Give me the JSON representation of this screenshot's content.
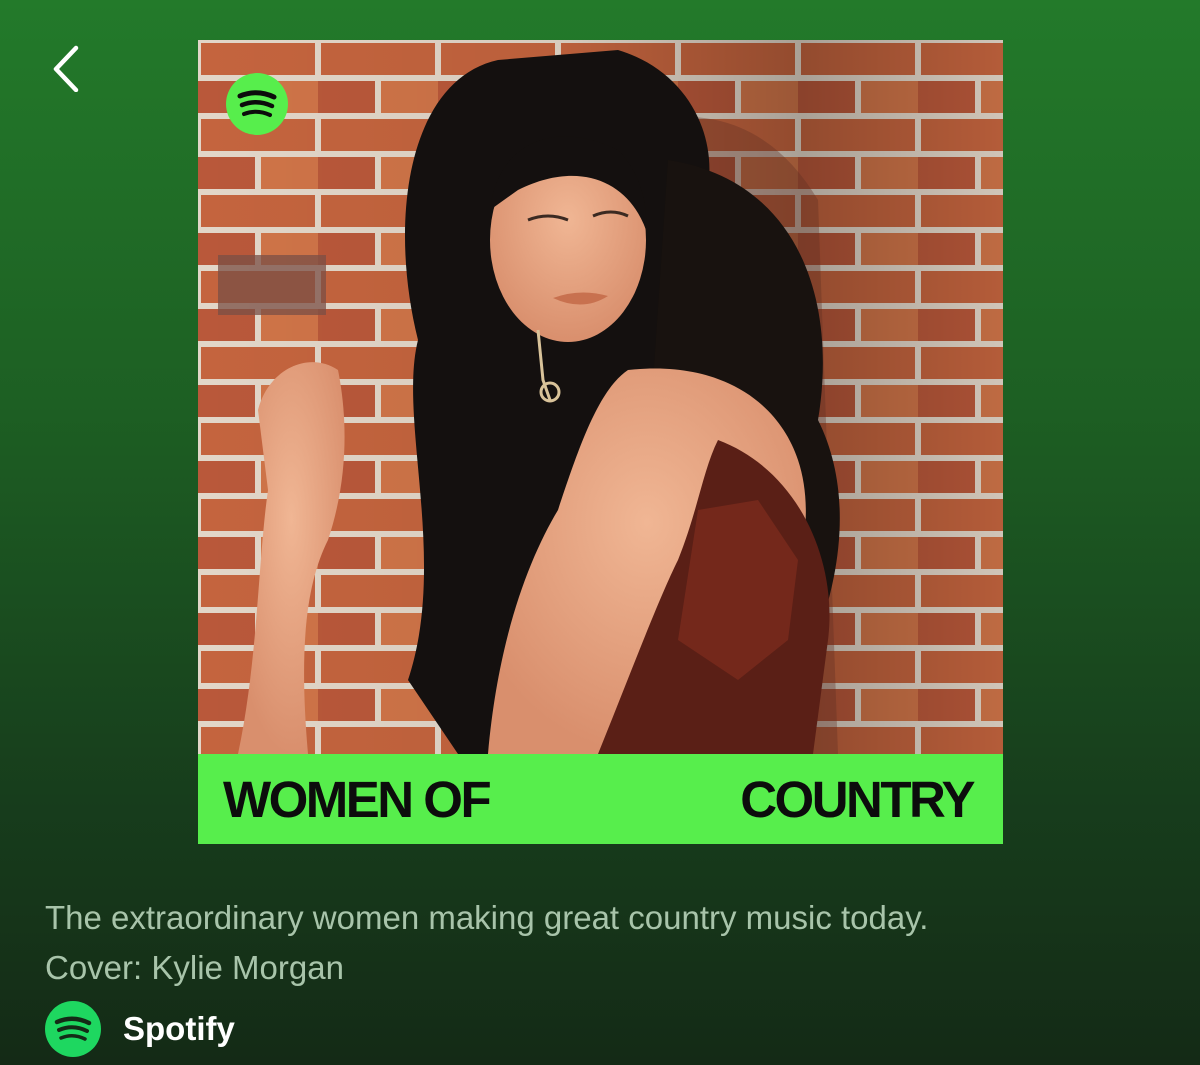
{
  "navigation": {
    "back_icon": "chevron-left-icon"
  },
  "playlist": {
    "cover": {
      "logo_icon": "spotify-logo-icon",
      "banner_left": "WOMEN OF",
      "banner_right": "COUNTRY",
      "banner_color": "#57ee4c"
    },
    "description_line1": "The extraordinary women making great country music today.",
    "description_line2": "Cover: Kylie Morgan",
    "owner": {
      "name": "Spotify",
      "logo_icon": "spotify-logo-icon"
    }
  },
  "colors": {
    "background_top": "#237a2a",
    "background_bottom": "#142a16",
    "spotify_green": "#1ed760",
    "text_muted": "#a8c4aa",
    "text_white": "#ffffff"
  }
}
